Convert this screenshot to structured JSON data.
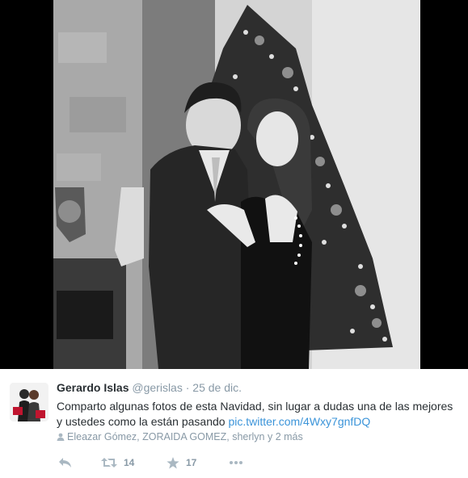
{
  "media": {
    "description_icon": "photo",
    "colors": {
      "frame": "#000000",
      "photo_bg": "#bdbdbd"
    }
  },
  "tweet": {
    "author_name": "Gerardo Islas",
    "author_handle": "@gerislas",
    "separator": "·",
    "date": "25 de dic.",
    "text_line1": "Comparto algunas fotos de esta Navidad, sin lugar a dudas una de las mejores",
    "text_line2": "y ustedes como la están pasando",
    "link": "pic.twitter.com/4Wxy7gnfDQ",
    "context_icon": "person-icon",
    "context": "Eleazar Gómez, ZORAIDA GOMEZ, sherlyn y 2 más"
  },
  "actions": {
    "reply_icon": "reply-icon",
    "retweet_icon": "retweet-icon",
    "retweet_count": "14",
    "favorite_icon": "star-icon",
    "favorite_count": "17",
    "more_icon": "more-icon"
  },
  "colors": {
    "name": "#292f33",
    "meta": "#8899a6",
    "link": "#3b94d9",
    "icon": "#aab8c2"
  }
}
